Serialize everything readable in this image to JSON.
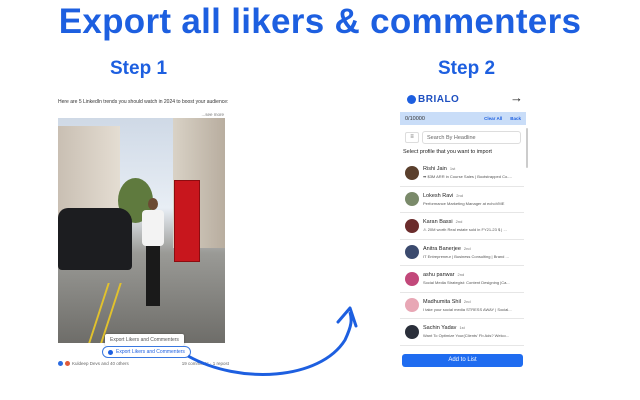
{
  "title": "Export all likers & commenters",
  "step1": "Step 1",
  "step2": "Step 2",
  "post": {
    "caption": "Here are 5 LinkedIn trends you should watch in 2024 to boost your audience:",
    "see_more": "...see more",
    "tooltip": "Export Likers and Commenters",
    "export_button": "Export Likers and Commenters",
    "reactions": "Kuldeep Devs and 40 others",
    "comments": "19 comments · 1 repost"
  },
  "panel": {
    "brand": "BRIALO",
    "count": "0/10000",
    "clear_all": "Clear All",
    "back": "Back",
    "search_placeholder": "Search By Headline",
    "instruction": "Select profile that you want to import",
    "add_button": "Add to List",
    "profiles": [
      {
        "name": "Rishi Jain",
        "degree": "1st",
        "headline": "➡ $3M ARR in Course Sales | Bootstrapped Co-...",
        "color": "#5a3f2c"
      },
      {
        "name": "Lokesh Ravi",
        "degree": "2nd",
        "headline": "Performance Marketing Manager at echoVME",
        "color": "#7a8a6a"
      },
      {
        "name": "Karan Bassi",
        "degree": "2nd",
        "headline": "⚠ 20M worth Real estate sold in FY21-23 $ | ...",
        "color": "#6b2c2c"
      },
      {
        "name": "Anitra Banerjee",
        "degree": "2nd",
        "headline": "IT Entrepreneur | Business Consulting | Brand ...",
        "color": "#3b4a6e"
      },
      {
        "name": "ashu panwar",
        "degree": "2nd",
        "headline": "Social Media Strategist: Content Designing |Ca...",
        "color": "#c2487a"
      },
      {
        "name": "Madhumita Shil",
        "degree": "2nd",
        "headline": "I take your social media STRESS AWAY | Social...",
        "color": "#e8a7b5"
      },
      {
        "name": "Sachin Yadav",
        "degree": "1st",
        "headline": "Want To Optimize Your(Clients' Fb Ads? Welco...",
        "color": "#2a2f3a"
      }
    ]
  },
  "colors": {
    "accent": "#1d5fe0"
  }
}
